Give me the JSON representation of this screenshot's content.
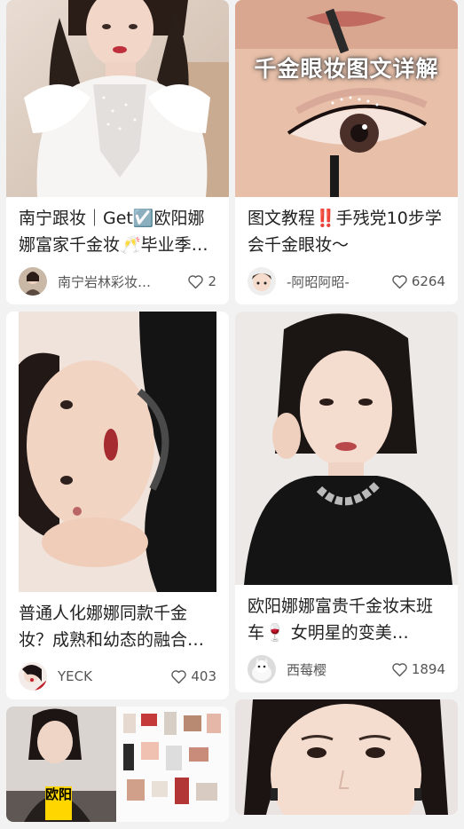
{
  "feed": {
    "cards": [
      {
        "title": "南宁跟妆｜Get☑️欧阳娜娜富家千金妆🥂毕业季…",
        "author": "南宁岩林彩妆…",
        "likes": "2",
        "image": "bride-white-gown-photo"
      },
      {
        "overlay_text": "千金眼妆图文详解",
        "title": "图文教程‼️手残党10步学会千金眼妆～",
        "author": "-阿昭阿昭-",
        "likes": "6264",
        "image": "eye-makeup-closeup-photo"
      },
      {
        "title": "普通人化娜娜同款千金妆？成熟和幼态的融合…",
        "author": "YECK",
        "likes": "403",
        "image": "woman-lying-black-top-photo"
      },
      {
        "title": "欧阳娜娜富贵千金妆末班车🍷 女明星的变美…",
        "author": "西莓樱",
        "likes": "1894",
        "image": "woman-black-top-chain-necklace-photo"
      },
      {
        "overlay_tag": "欧阳",
        "image": "makeup-products-collage-photo"
      },
      {
        "image": "woman-face-closeup-photo"
      }
    ]
  },
  "colors": {
    "background": "#f2f2f2",
    "card": "#ffffff",
    "text": "#222222",
    "meta_text": "#555555"
  }
}
